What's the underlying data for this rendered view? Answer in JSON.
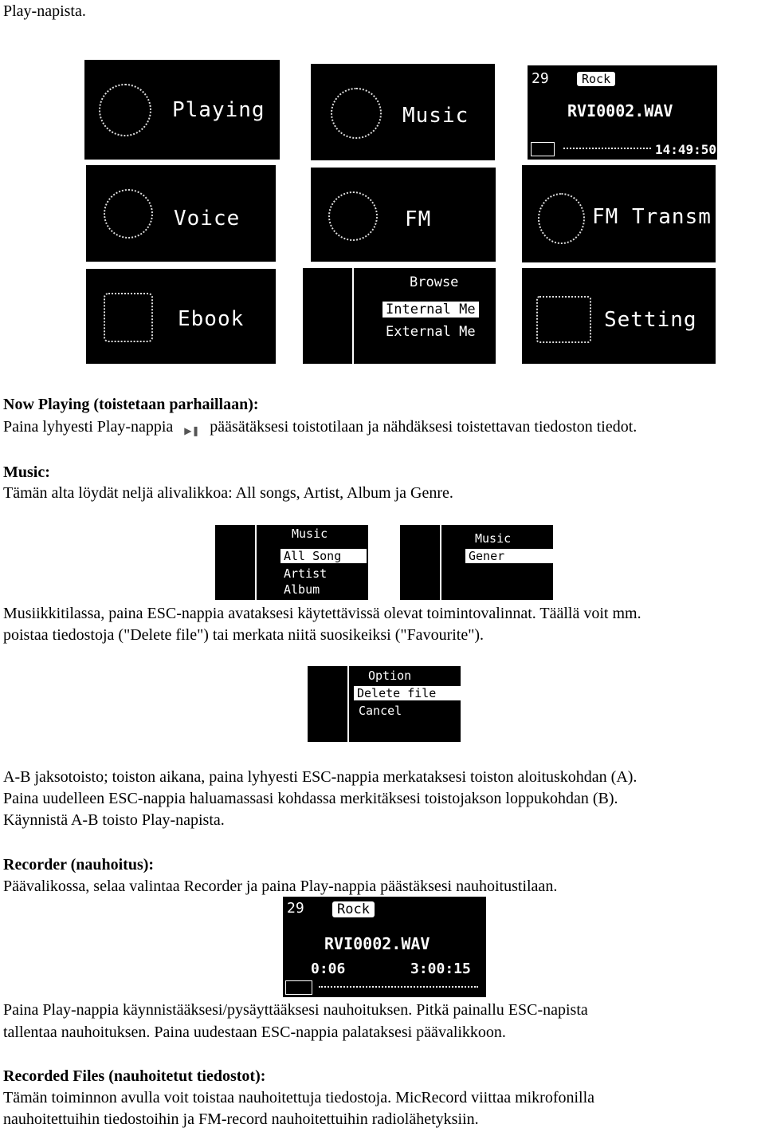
{
  "intro": "Play-napista.",
  "menu_screens": [
    {
      "label": "Playing",
      "icon": "headphones-play-icon"
    },
    {
      "label": "Music",
      "icon": "music-icon"
    },
    {
      "label": "Voice",
      "icon": "speaker-icon"
    },
    {
      "label": "FM",
      "icon": "radio-icon"
    },
    {
      "label": "FM Transm",
      "icon": "antenna-icon"
    },
    {
      "label": "Ebook",
      "icon": "ebook-icon"
    },
    {
      "label": "Setting",
      "icon": "tools-icon"
    }
  ],
  "browse_screen": {
    "title": "Browse",
    "items": [
      "Internal Me",
      "External Me"
    ]
  },
  "player_screen": {
    "volume": "29",
    "eq": "Rock",
    "filename": "RVI0002.WAV",
    "time": "14:49:50"
  },
  "sections": {
    "now_playing_title": "Now Playing (toistetaan parhaillaan):",
    "now_playing_a": "Paina lyhyesti Play-nappia",
    "now_playing_b": "pääsätäksesi toistotilaan ja nähdäksesi toistettavan tiedoston tiedot.",
    "music_title": "Music:",
    "music_text": "Tämän alta löydät neljä alivalikkoa: All songs, Artist, Album ja Genre.",
    "music_esc_1": "Musiikkitilassa, paina ESC-nappia avataksesi käytettävissä olevat toimintovalinnat. Täällä voit mm.",
    "music_esc_2": "poistaa tiedostoja (\"Delete file\") tai merkata niitä suosikeiksi (\"Favourite\").",
    "ab_1": "A-B jaksotoisto; toiston aikana, paina lyhyesti ESC-nappia merkataksesi toiston aloituskohdan (A).",
    "ab_2": "Paina uudelleen ESC-nappia haluamassasi kohdassa merkitäksesi toistojakson loppukohdan (B).",
    "ab_3": "Käynnistä A-B toisto Play-napista.",
    "recorder_title": "Recorder (nauhoitus):",
    "recorder_text": "Päävalikossa, selaa valintaa Recorder ja paina Play-nappia päästäksesi nauhoitustilaan.",
    "rec_play_1": "Paina Play-nappia käynnistääksesi/pysäyttääksesi nauhoituksen. Pitkä painallu ESC-napista",
    "rec_play_2": "tallentaa nauhoituksen. Paina uudestaan ESC-nappia palataksesi päävalikkoon.",
    "files_title": "Recorded Files (nauhoitetut tiedostot):",
    "files_1": "Tämän toiminnon avulla voit toistaa nauhoitettuja tiedostoja. MicRecord viittaa mikrofonilla",
    "files_2": "nauhoitettuihin tiedostoihin ja FM-record nauhoitettuihin radiolähetyksiin."
  },
  "music_menu_1": {
    "title": "Music",
    "items": [
      "All Song",
      "Artist",
      "Album"
    ]
  },
  "music_menu_2": {
    "title": "Music",
    "items": [
      "Gener"
    ]
  },
  "option_menu": {
    "title": "Option",
    "items": [
      "Delete file",
      "Cancel"
    ]
  },
  "recorder_screen": {
    "volume": "29",
    "eq": "Rock",
    "filename": "RVI0002.WAV",
    "elapsed": "0:06",
    "remaining": "3:00:15"
  }
}
